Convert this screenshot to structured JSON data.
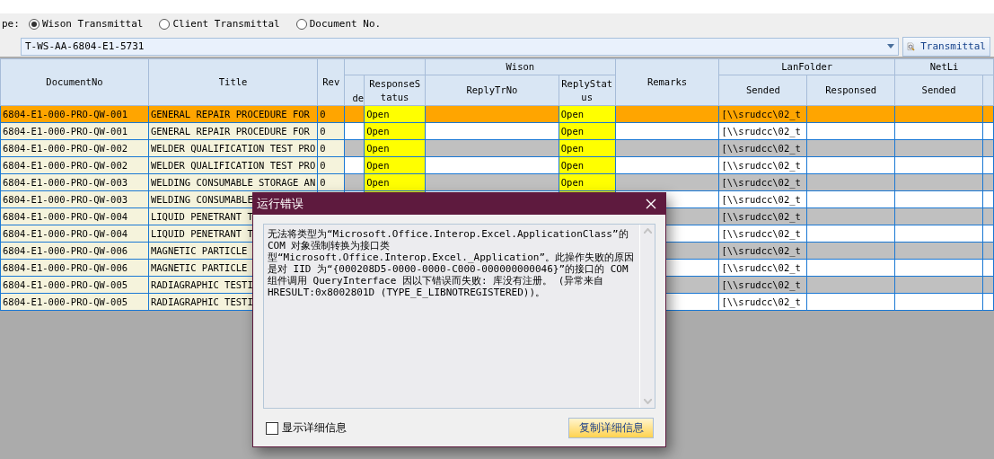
{
  "filter": {
    "label": "pe:",
    "options": [
      {
        "label": "Wison Transmittal",
        "selected": true
      },
      {
        "label": "Client Transmittal",
        "selected": false
      },
      {
        "label": "Document No.",
        "selected": false
      }
    ]
  },
  "search": {
    "value": "T-WS-AA-6804-E1-5731",
    "button": "Transmittal"
  },
  "table": {
    "columns": [
      {
        "label": "DocumentNo"
      },
      {
        "label": "Title"
      },
      {
        "label": "Rev"
      },
      {
        "columns": [
          {
            "label": "de"
          },
          {
            "label": "ResponseStatus"
          }
        ]
      },
      {
        "group": "Wison",
        "columns": [
          {
            "label": "ReplyTrNo"
          },
          {
            "label": "ReplyStatus"
          }
        ]
      },
      {
        "label": "Remarks"
      },
      {
        "group": "LanFolder",
        "columns": [
          {
            "label": "Sended"
          },
          {
            "label": "Responsed"
          }
        ]
      },
      {
        "group": "NetLi",
        "columns": [
          {
            "label": "Sended"
          }
        ]
      }
    ],
    "rows": [
      {
        "selected": true,
        "doc_no": "6804-E1-000-PRO-QW-001",
        "title": "GENERAL REPAIR PROCEDURE FOR",
        "rev": "0",
        "response_status": "Open",
        "reply_status": "Open",
        "lan_sended": "[\\\\srudcc\\02_t"
      },
      {
        "selected": false,
        "doc_no": "6804-E1-000-PRO-QW-001",
        "title": "GENERAL REPAIR PROCEDURE FOR",
        "rev": "0",
        "response_status": "Open",
        "reply_status": "Open",
        "lan_sended": "[\\\\srudcc\\02_t"
      },
      {
        "selected": false,
        "doc_no": "6804-E1-000-PRO-QW-002",
        "title": "WELDER QUALIFICATION TEST PRO",
        "rev": "0",
        "response_status": "Open",
        "reply_status": "Open",
        "lan_sended": "[\\\\srudcc\\02_t"
      },
      {
        "selected": false,
        "doc_no": "6804-E1-000-PRO-QW-002",
        "title": "WELDER QUALIFICATION TEST PRO",
        "rev": "0",
        "response_status": "Open",
        "reply_status": "Open",
        "lan_sended": "[\\\\srudcc\\02_t"
      },
      {
        "selected": false,
        "doc_no": "6804-E1-000-PRO-QW-003",
        "title": "WELDING CONSUMABLE STORAGE AN",
        "rev": "0",
        "response_status": "Open",
        "reply_status": "Open",
        "lan_sended": "[\\\\srudcc\\02_t"
      },
      {
        "selected": false,
        "doc_no": "6804-E1-000-PRO-QW-003",
        "title": "WELDING CONSUMABLE",
        "lan_sended": "[\\\\srudcc\\02_t"
      },
      {
        "selected": false,
        "doc_no": "6804-E1-000-PRO-QW-004",
        "title": "LIQUID PENETRANT T",
        "lan_sended": "[\\\\srudcc\\02_t"
      },
      {
        "selected": false,
        "doc_no": "6804-E1-000-PRO-QW-004",
        "title": "LIQUID PENETRANT T",
        "lan_sended": "[\\\\srudcc\\02_t"
      },
      {
        "selected": false,
        "doc_no": "6804-E1-000-PRO-QW-006",
        "title": "MAGNETIC PARTICLE",
        "lan_sended": "[\\\\srudcc\\02_t"
      },
      {
        "selected": false,
        "doc_no": "6804-E1-000-PRO-QW-006",
        "title": "MAGNETIC PARTICLE",
        "lan_sended": "[\\\\srudcc\\02_t"
      },
      {
        "selected": false,
        "doc_no": "6804-E1-000-PRO-QW-005",
        "title": "RADIAGRAPHIC TESTI",
        "lan_sended": "[\\\\srudcc\\02_t"
      },
      {
        "selected": false,
        "doc_no": "6804-E1-000-PRO-QW-005",
        "title": "RADIAGRAPHIC TESTI",
        "lan_sended": "[\\\\srudcc\\02_t"
      }
    ]
  },
  "dialog": {
    "title": "运行错误",
    "message": "无法将类型为“Microsoft.Office.Interop.Excel.ApplicationClass”的COM 对象强制转换为接口类型“Microsoft.Office.Interop.Excel._Application”。此操作失败的原因是对 IID 为“{000208D5-0000-0000-C000-000000000046}”的接口的 COM 组件调用 QueryInterface 因以下错误而失败: 库没有注册。 (异常来自 HRESULT:0x8002801D (TYPE_E_LIBNOTREGISTERED))。",
    "checkbox": {
      "label": "显示详细信息",
      "checked": false
    },
    "button": "复制详细信息"
  }
}
